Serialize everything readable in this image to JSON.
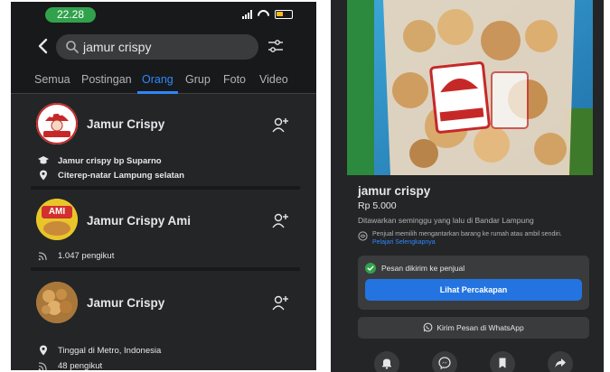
{
  "left": {
    "status": {
      "time": "22.28"
    },
    "search": {
      "query": "jamur crispy"
    },
    "tabs": [
      {
        "label": "Semua",
        "active": false
      },
      {
        "label": "Postingan",
        "active": false
      },
      {
        "label": "Orang",
        "active": true
      },
      {
        "label": "Grup",
        "active": false
      },
      {
        "label": "Foto",
        "active": false
      },
      {
        "label": "Video",
        "active": false
      }
    ],
    "results": [
      {
        "name": "Jamur Crispy",
        "meta": [
          {
            "icon": "education-icon",
            "text": "Jamur crispy bp Suparno"
          },
          {
            "icon": "location-icon",
            "text": "Citerep-natar Lampung selatan"
          }
        ]
      },
      {
        "name": "Jamur Crispy Ami",
        "avatar_text": "AMI",
        "meta": [
          {
            "icon": "followers-icon",
            "text": "1.047 pengikut"
          }
        ]
      },
      {
        "name": "Jamur Crispy",
        "meta": [
          {
            "icon": "location-icon",
            "text": "Tinggal di Metro, Indonesia"
          },
          {
            "icon": "followers-icon",
            "text": "48 pengikut"
          }
        ]
      }
    ],
    "colors": {
      "accent": "#2d88ff",
      "background": "#242526"
    }
  },
  "right": {
    "listing": {
      "title": "jamur crispy",
      "price": "Rp 5.000",
      "posted": "Ditawarkan seminggu yang lalu di Bandar Lampung",
      "delivery_note": "Penjual memilih mengantarkan barang ke rumah atau ambil sendiri.",
      "learn_more": "Pelajari Selengkapnya"
    },
    "message": {
      "sent_label": "Pesan dikirim ke penjual",
      "view_button": "Lihat Percakapan"
    },
    "whatsapp_button": "Kirim Pesan di WhatsApp",
    "actions": [
      "bell-icon",
      "messenger-icon",
      "bookmark-icon",
      "share-icon"
    ],
    "colors": {
      "button_blue": "#2374e1",
      "check_green": "#31a24c"
    }
  }
}
